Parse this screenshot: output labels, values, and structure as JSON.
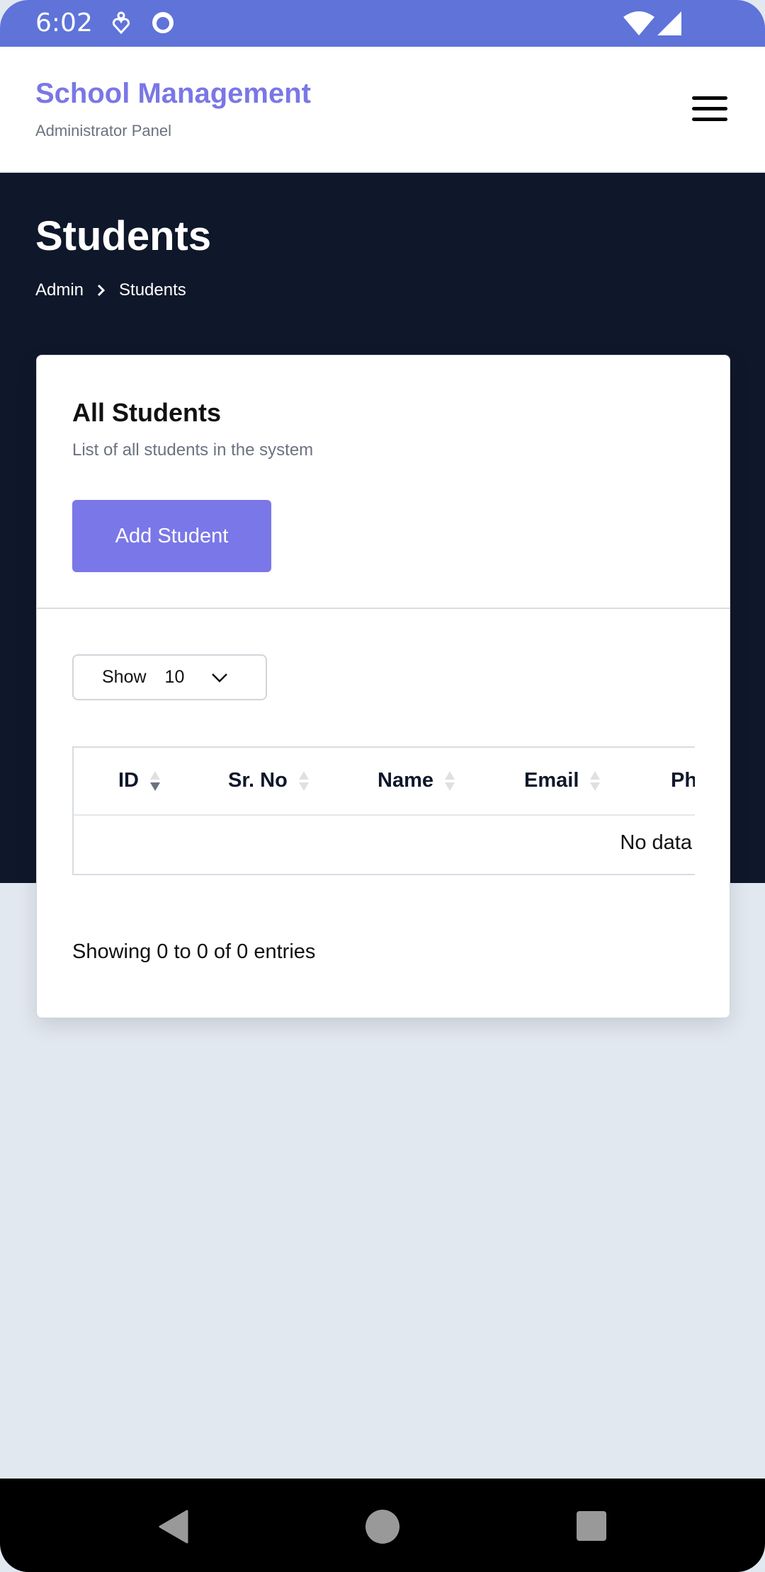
{
  "status_bar": {
    "time": "6:02",
    "icons": [
      "accessibility-icon",
      "cat-face-icon",
      "wifi-icon",
      "signal-icon"
    ],
    "color": "#5f73d9"
  },
  "header": {
    "title": "School Management",
    "subtitle": "Administrator Panel",
    "menu_icon": "hamburger-icon",
    "accent": "#7a77e6"
  },
  "page": {
    "title": "Students",
    "breadcrumb": [
      "Admin",
      "Students"
    ]
  },
  "card": {
    "title": "All Students",
    "subtitle": "List of all students in the system",
    "add_button": "Add Student",
    "page_size": {
      "label": "Show",
      "value": "10"
    },
    "table": {
      "columns": [
        "ID",
        "Sr. No",
        "Name",
        "Email",
        "Ph"
      ],
      "sorted_column": "ID",
      "sort_direction": "descending",
      "empty_text": "No data"
    },
    "footer": "Showing 0 to 0 of 0 entries"
  },
  "nav_bar": {
    "buttons": [
      "back",
      "home",
      "recents"
    ]
  }
}
